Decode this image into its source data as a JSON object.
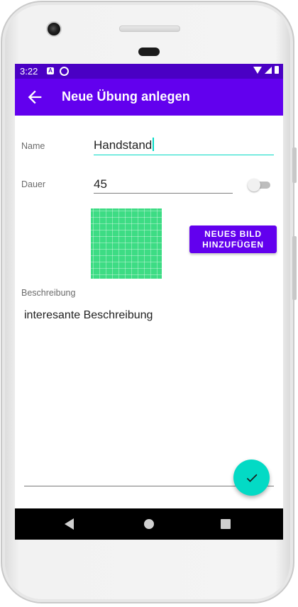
{
  "status_bar": {
    "time": "3:22",
    "notification_icons": [
      "a-badge-icon",
      "sync-icon"
    ],
    "system_icons": [
      "wifi-icon",
      "signal-icon",
      "battery-icon"
    ]
  },
  "app_bar": {
    "title": "Neue Übung anlegen",
    "back_icon": "arrow-back-icon",
    "color": "#6200ee",
    "status_color": "#4a00c4"
  },
  "form": {
    "name_label": "Name",
    "name_value": "Handstand",
    "dauer_label": "Dauer",
    "dauer_value": "45",
    "dauer_switch_on": false,
    "image_preview_icon": "grid-image-placeholder",
    "add_image_button": "NEUES BILD\nHINZUFÜGEN",
    "description_label": "Beschreibung",
    "description_value": "interesante Beschreibung",
    "accent_color": "#03dac5"
  },
  "fab": {
    "icon": "check-icon"
  },
  "nav_bar": {
    "icons": [
      "nav-back-icon",
      "nav-home-icon",
      "nav-recents-icon"
    ]
  }
}
